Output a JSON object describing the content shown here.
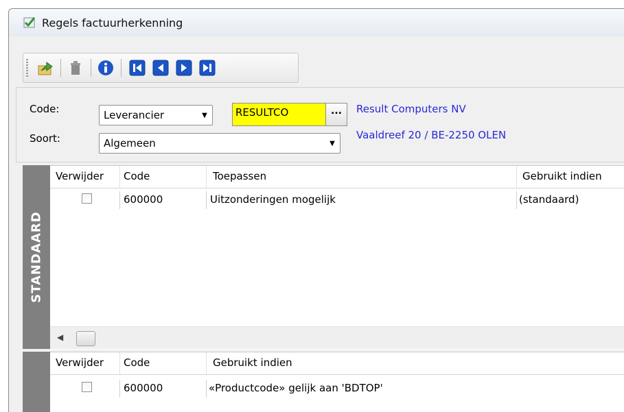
{
  "window": {
    "title": "Regels factuurherkenning",
    "title_icon": "checkmark-document-icon"
  },
  "toolbar": {
    "buttons": [
      {
        "icon": "export-arrow-icon"
      },
      {
        "icon": "trash-icon"
      },
      {
        "icon": "info-icon"
      },
      {
        "icon": "first-record-icon"
      },
      {
        "icon": "previous-record-icon"
      },
      {
        "icon": "next-record-icon"
      },
      {
        "icon": "last-record-icon"
      }
    ]
  },
  "header": {
    "code_label": "Code:",
    "code_type": "Leverancier",
    "code_value": "RESULTCO",
    "lookup_label": "...",
    "soort_label": "Soort:",
    "soort_value": "Algemeen",
    "supplier_name": "Result Computers NV",
    "supplier_address": "Vaaldreef 20 / BE-2250 OLEN"
  },
  "standard_grid": {
    "side_label": "STANDAARD",
    "columns": [
      "Verwijder",
      "Code",
      "Toepassen",
      "Gebruikt indien"
    ],
    "rows": [
      {
        "verwijder": false,
        "code": "600000",
        "toepassen": "Uitzonderingen mogelijk",
        "gebruikt_indien": "(standaard)"
      }
    ]
  },
  "exception_grid": {
    "columns": [
      "Verwijder",
      "Code",
      "Gebruikt indien"
    ],
    "rows": [
      {
        "verwijder": false,
        "code": "600000",
        "gebruikt_indien": "«Productcode» gelijk aan 'BDTOP'"
      }
    ]
  },
  "colors": {
    "highlight_field": "#ffff00",
    "supplier_link": "#2828d8",
    "side_tab": "#808080"
  }
}
